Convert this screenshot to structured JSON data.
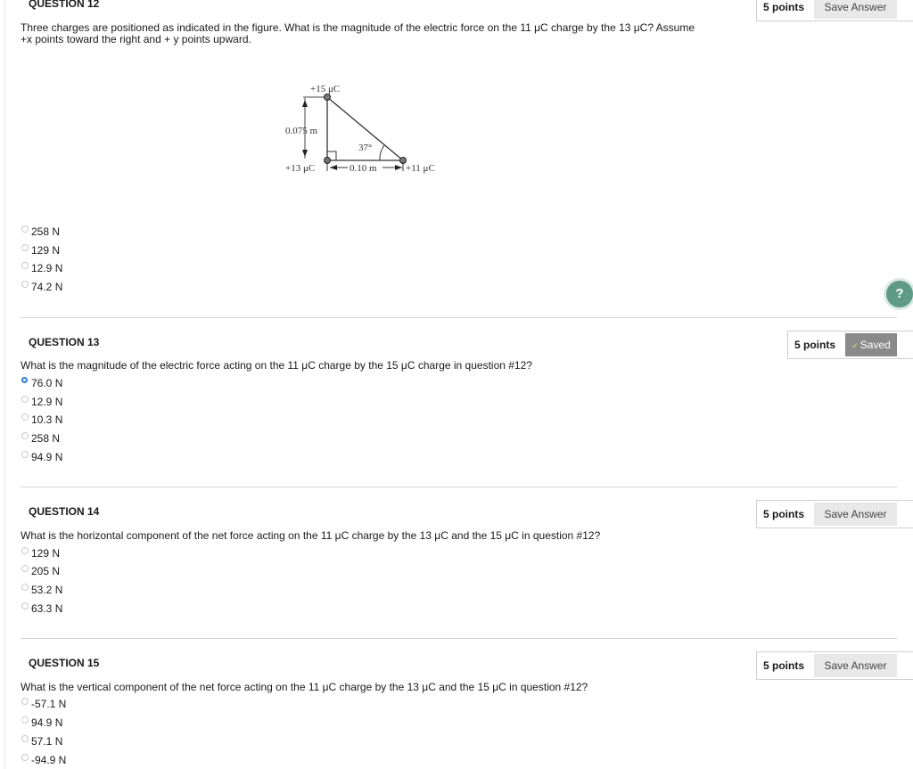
{
  "questions": [
    {
      "title": "QUESTION 12",
      "points": "5 points",
      "action": "Save Answer",
      "text_line1": "Three charges are positioned as indicated in the figure. What is the magnitude of the electric force on the 11 μC charge by the 13 μC? Assume",
      "text_line2": "+x points toward the right and + y points upward.",
      "figure": {
        "top_charge": "+15 μC",
        "left_charge": "+13 μC",
        "right_charge": "+11 μC",
        "vertical_dim": "0.075 m",
        "horizontal_dim": "0.10 m",
        "angle": "37°"
      },
      "options": [
        "258 N",
        "129 N",
        "12.9 N",
        "74.2 N"
      ]
    },
    {
      "title": "QUESTION 13",
      "points": "5 points",
      "action": "Saved",
      "text_line1": "What is the magnitude of the electric force acting on the 11 μC charge by the 15 μC charge in question #12?",
      "options": [
        "76.0 N",
        "12.9 N",
        "10.3 N",
        "258 N",
        "94.9 N"
      ],
      "selected": "76.0 N"
    },
    {
      "title": "QUESTION 14",
      "points": "5 points",
      "action": "Save Answer",
      "text_line1": "What is the horizontal component of the net force acting on the 11 μC charge by the 13 μC and the 15 μC in question #12?",
      "options": [
        "129 N",
        "205 N",
        "53.2 N",
        "63.3 N"
      ]
    },
    {
      "title": "QUESTION 15",
      "points": "5 points",
      "action": "Save Answer",
      "text_line1": "What is the vertical component of the net force acting on the 11 μC charge by the 13 μC and the 15 μC in question #12?",
      "options": [
        "-57.1 N",
        "94.9 N",
        "57.1 N",
        "-94.9 N"
      ]
    }
  ],
  "help": {
    "icon": "question-mark-icon",
    "glyph": "?"
  }
}
